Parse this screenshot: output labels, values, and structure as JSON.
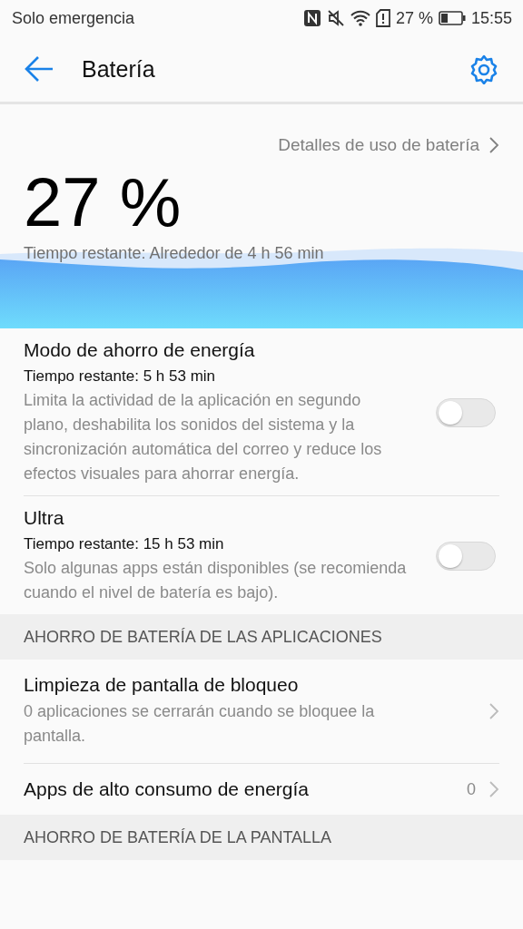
{
  "status_bar": {
    "carrier": "Solo emergencia",
    "battery_text": "27 %",
    "time": "15:55"
  },
  "header": {
    "title": "Batería"
  },
  "details_link": "Detalles de uso de batería",
  "battery": {
    "percent": "27 %",
    "remaining": "Tiempo restante: Alrededor de 4 h 56 min"
  },
  "modes": [
    {
      "title": "Modo de ahorro de energía",
      "remaining": "Tiempo restante: 5 h 53 min",
      "description": "Limita la actividad de la aplicación en segundo plano, deshabilita los sonidos del sistema y la sincronización automática del correo y reduce los efectos visuales para ahorrar energía.",
      "on": false
    },
    {
      "title": "Ultra",
      "remaining": "Tiempo restante: 15 h 53 min",
      "description": "Solo algunas apps están disponibles (se recomienda cuando el nivel de batería es bajo).",
      "on": false
    }
  ],
  "sections": [
    {
      "heading": "AHORRO DE BATERÍA DE LAS APLICACIONES",
      "items": [
        {
          "kind": "link",
          "title": "Limpieza de pantalla de bloqueo",
          "description": "0 aplicaciones se cerrarán cuando se bloquee la pantalla."
        },
        {
          "kind": "count",
          "title": "Apps de alto consumo de energía",
          "value": "0"
        }
      ]
    },
    {
      "heading": "AHORRO DE BATERÍA DE LA PANTALLA"
    }
  ]
}
